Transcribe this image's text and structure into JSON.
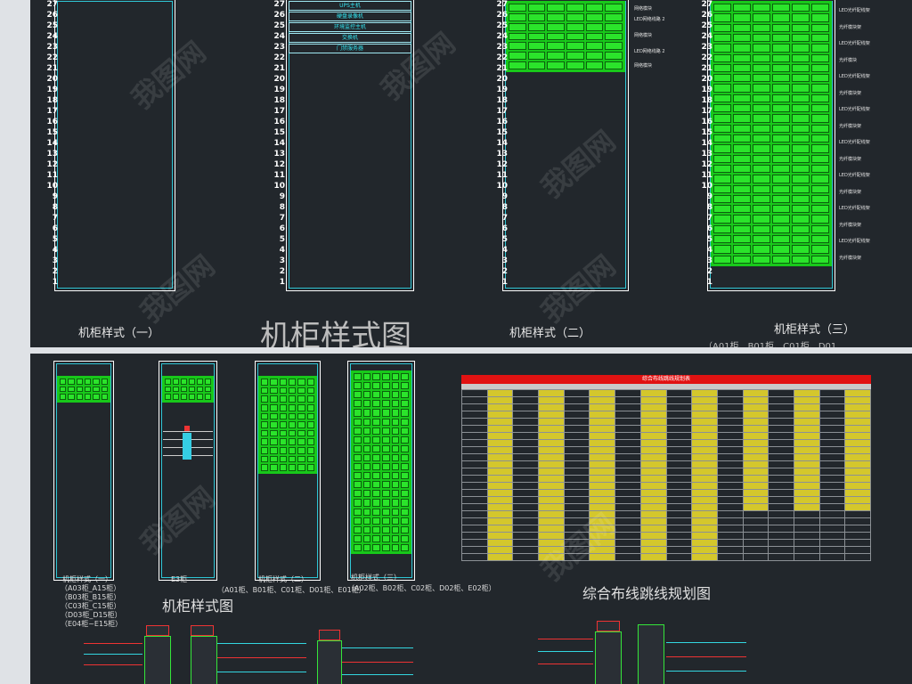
{
  "rack_units": [
    "27",
    "26",
    "25",
    "24",
    "23",
    "22",
    "21",
    "20",
    "19",
    "18",
    "17",
    "16",
    "15",
    "14",
    "13",
    "12",
    "11",
    "10",
    "9",
    "8",
    "7",
    "6",
    "5",
    "4",
    "3",
    "2",
    "1"
  ],
  "top": {
    "title": "机柜样式图",
    "captions": {
      "style1": "机柜样式（一）",
      "style2": "机柜样式（二）",
      "style3": "机柜样式（三）",
      "e3": "E3柜"
    },
    "rack2_equipment": [
      "UPS主机",
      "硬盘录像机",
      "环境监控主机",
      "交换机",
      "门禁服务器"
    ],
    "rack3_labels": [
      "网络模块",
      "LED网络线路 2",
      "网络模块",
      "LED网络线路 2",
      "网络模块"
    ],
    "rack4_labels": [
      "LED光纤配线架",
      "光纤模块架",
      "LED光纤配线架",
      "光纤模块",
      "LED光纤配线架",
      "光纤模块架",
      "LED光纤配线架",
      "光纤模块架",
      "LED光纤配线架",
      "光纤模块架",
      "LED光纤配线架",
      "光纤模块架",
      "LED光纤配线架",
      "光纤模块架",
      "LED光纤配线架",
      "光纤模块架"
    ],
    "cut_text": "（A01柜、B01柜、C01柜、D01"
  },
  "bottom": {
    "rack_titles": {
      "r1": "机柜样式（一）",
      "r2": "E3柜",
      "r3": "机柜样式（二）",
      "r4": "机柜样式（三）"
    },
    "r1_sub": [
      "（A03柜_A15柜）",
      "（B03柜_B15柜）",
      "（C03柜_C15柜）",
      "（D03柜_D15柜）",
      "（E04柜~E15柜）"
    ],
    "r3_sub": "（A01柜、B01柜、C01柜、D01柜、E01柜）",
    "r4_sub": "（A02柜、B02柜、C02柜、D02柜、E02柜）",
    "left_title": "机柜样式图",
    "right_title": "综合布线跳线规划图",
    "table_title": "综合布线跳线规划表"
  },
  "watermark": "我图网"
}
